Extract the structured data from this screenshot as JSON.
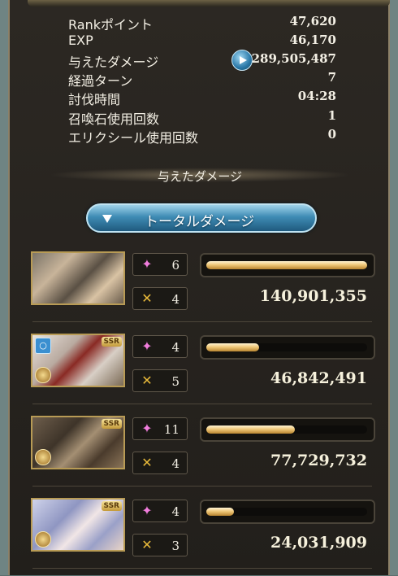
{
  "stats": {
    "rank_points": {
      "label": "Rankポイント",
      "value": "47,620"
    },
    "exp": {
      "label": "EXP",
      "value": "46,170"
    },
    "damage_dealt": {
      "label": "与えたダメージ",
      "value": "289,505,487"
    },
    "turns": {
      "label": "経過ターン",
      "value": "7"
    },
    "time": {
      "label": "討伐時間",
      "value": "04:28"
    },
    "summon_uses": {
      "label": "召喚石使用回数",
      "value": "1"
    },
    "elixir_uses": {
      "label": "エリクシール使用回数",
      "value": "0"
    }
  },
  "section_title": "与えたダメージ",
  "tab_label": "トータルダメージ",
  "characters": [
    {
      "skill_count": "6",
      "attack_count": "4",
      "damage": "140,901,355",
      "bar_fraction": 1.0,
      "ssr": false,
      "badge": false
    },
    {
      "skill_count": "4",
      "attack_count": "5",
      "damage": "46,842,491",
      "bar_fraction": 0.33,
      "ssr": true,
      "ssr_label": "SSR",
      "badge": true
    },
    {
      "skill_count": "11",
      "attack_count": "4",
      "damage": "77,729,732",
      "bar_fraction": 0.55,
      "ssr": true,
      "ssr_label": "SSR",
      "badge": false
    },
    {
      "skill_count": "4",
      "attack_count": "3",
      "damage": "24,031,909",
      "bar_fraction": 0.17,
      "ssr": true,
      "ssr_label": "SSR",
      "badge": false
    }
  ],
  "colors": {
    "accent": "#3f8cb5",
    "bar_fill": "#f0c97a",
    "skill_icon": "#f07ddc",
    "attack_icon": "#e8b93a"
  }
}
